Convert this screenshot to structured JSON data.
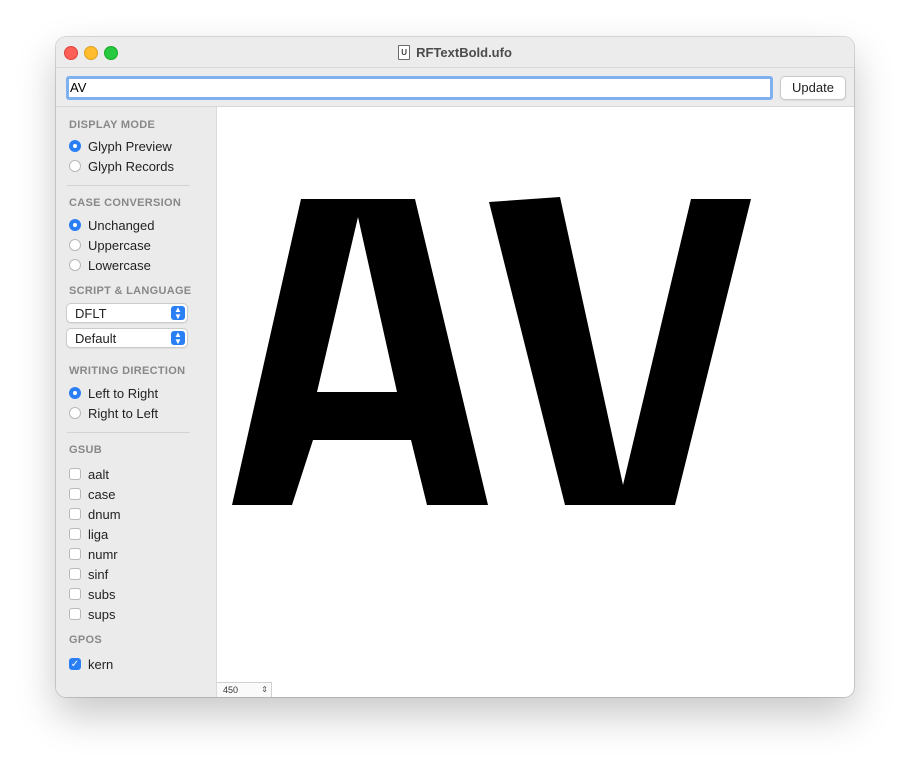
{
  "window": {
    "title": "RFTextBold.ufo",
    "doc_icon_glyph": "U"
  },
  "toolbar": {
    "text_value": "AV",
    "update_label": "Update"
  },
  "sidebar": {
    "display_mode": {
      "title": "DISPLAY MODE",
      "options": [
        "Glyph Preview",
        "Glyph Records"
      ],
      "selected": "Glyph Preview"
    },
    "case_conversion": {
      "title": "CASE CONVERSION",
      "options": [
        "Unchanged",
        "Uppercase",
        "Lowercase"
      ],
      "selected": "Unchanged"
    },
    "script_language": {
      "title": "SCRIPT & LANGUAGE",
      "script": "DFLT",
      "language": "Default"
    },
    "writing_direction": {
      "title": "WRITING DIRECTION",
      "options": [
        "Left to Right",
        "Right to Left"
      ],
      "selected": "Left to Right"
    },
    "gsub": {
      "title": "GSUB",
      "features": [
        {
          "tag": "aalt",
          "checked": false
        },
        {
          "tag": "case",
          "checked": false
        },
        {
          "tag": "dnum",
          "checked": false
        },
        {
          "tag": "liga",
          "checked": false
        },
        {
          "tag": "numr",
          "checked": false
        },
        {
          "tag": "sinf",
          "checked": false
        },
        {
          "tag": "subs",
          "checked": false
        },
        {
          "tag": "sups",
          "checked": false
        }
      ]
    },
    "gpos": {
      "title": "GPOS",
      "features": [
        {
          "tag": "kern",
          "checked": true
        }
      ]
    }
  },
  "preview": {
    "glyphs": [
      "A",
      "V"
    ],
    "point_size": "450"
  },
  "colors": {
    "accent": "#2a7ff5",
    "glyph": "#000000"
  }
}
